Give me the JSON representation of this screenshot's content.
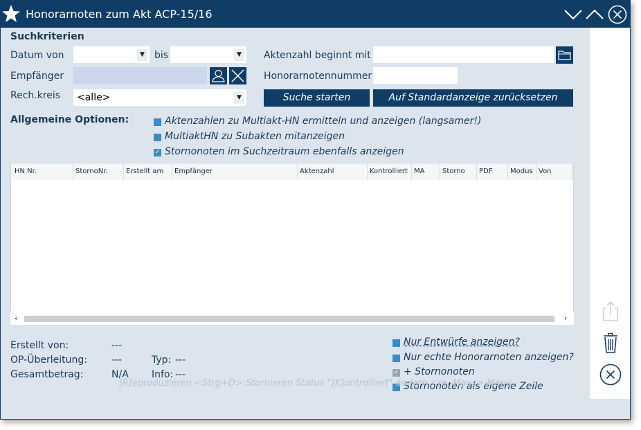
{
  "window": {
    "title": "Honorarnoten zum Akt ACP-15/16"
  },
  "search": {
    "header": "Suchkriterien",
    "datum_von_label": "Datum von",
    "datum_von_value": "",
    "bis_label": "bis",
    "bis_value": "",
    "empfaenger_label": "Empfänger",
    "empfaenger_value": "",
    "rechkreis_label": "Rech.kreis",
    "rechkreis_value": "<alle>",
    "aktenzahl_label": "Aktenzahl beginnt mit",
    "aktenzahl_value": "",
    "hn_nummer_label": "Honorarnotennummer",
    "hn_nummer_value": "",
    "search_button": "Suche starten",
    "reset_button": "Auf Standardanzeige zurücksetzen"
  },
  "options": {
    "header": "Allgemeine Optionen:",
    "items": [
      {
        "label": "Aktenzahlen zu Multiakt-HN ermitteln und anzeigen (langsamer!)",
        "checked": false
      },
      {
        "label": "MultiaktHN zu Subakten mitanzeigen",
        "checked": false
      },
      {
        "label": "Stornonoten im Suchzeitraum ebenfalls anzeigen",
        "checked": true
      }
    ]
  },
  "table": {
    "columns": [
      "HN Nr.",
      "StornoNr.",
      "Erstellt am",
      "Empfänger",
      "Aktenzahl",
      "Kontrolliert",
      "MA",
      "Storno",
      "PDF",
      "Modus",
      "Von"
    ],
    "rows": []
  },
  "info": {
    "erstellt_von_label": "Erstellt von:",
    "erstellt_von_value": "---",
    "op_label": "OP-Überleitung:",
    "op_value": "---",
    "typ_label": "Typ:",
    "typ_value": "---",
    "gesamt_label": "Gesamtbetrag:",
    "gesamt_value": "N/A",
    "info_label": "Info:",
    "info_value": "---"
  },
  "bottom_options": [
    {
      "label": "Nur Entwürfe anzeigen?",
      "state": "unchecked"
    },
    {
      "label": "Nur echte Honorarnoten anzeigen?",
      "state": "unchecked"
    },
    {
      "label": "+ Stornonoten",
      "state": "disabled-checked"
    },
    {
      "label": "Stornonoten als eigene Zeile",
      "state": "unchecked"
    }
  ],
  "statusbar": "[R]eproduzieren  <Strg+D>:Stornieren  Status \"[K]ontrolliert\" ändern  <re. Maus>:Menü",
  "colors": {
    "titlebar": "#0f3d66",
    "background": "#dce5ee",
    "accent": "#3b8cc4"
  },
  "icons": [
    "star-icon",
    "minimize-chevron-icon",
    "maximize-chevron-icon",
    "close-circle-icon",
    "folder-icon",
    "person-icon",
    "clear-x-icon",
    "share-icon",
    "trash-icon",
    "close-circle-icon"
  ]
}
